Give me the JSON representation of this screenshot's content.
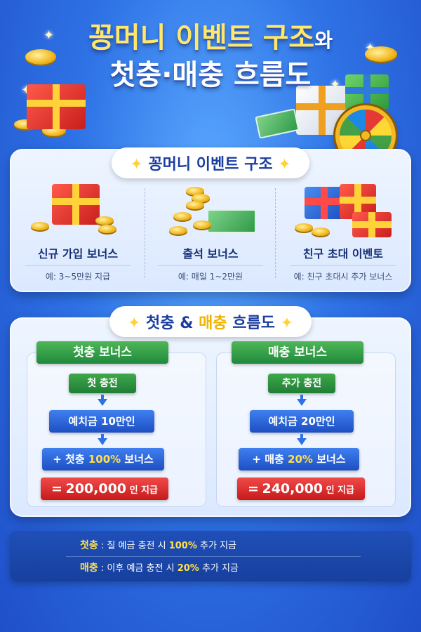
{
  "title": {
    "line1_main": "꽁머니 이벤트 구조",
    "line1_suffix": "와",
    "line2": "첫충·매충 흐름도"
  },
  "events_section": {
    "heading": "꽁머니 이벤트 구조",
    "items": [
      {
        "name": "신규 가입 보너스",
        "desc": "예: 3~5만원 지급"
      },
      {
        "name": "출석 보너스",
        "desc": "예: 매일 1~2만원"
      },
      {
        "name": "친구 초대 이벤토",
        "desc": "예: 친구 초대시 추가 보너스"
      }
    ]
  },
  "flow_section": {
    "heading_a": "첫충",
    "heading_amp": "&",
    "heading_b": "매충",
    "heading_c": "흐름도",
    "first": {
      "header": "첫충 보너스",
      "step1": "첫 충전",
      "step2": "예치금 10만인",
      "step3_prefix": "+ 첫충",
      "step3_pct": "100%",
      "step3_suffix": "보너스",
      "result_prefix": "=",
      "result_amount": "200,000",
      "result_suffix": "인 지급"
    },
    "reload": {
      "header": "매충 보너스",
      "step1": "추가 충전",
      "step2": "예치금 20만인",
      "step3_prefix": "+ 매충",
      "step3_pct": "20%",
      "step3_suffix": "보너스",
      "result_prefix": "=",
      "result_amount": "240,000",
      "result_suffix": "인 지급"
    }
  },
  "notes": [
    {
      "key": "첫충",
      "text_before": ": 칠 예금 충전 시",
      "pct": "100%",
      "text_after": "추가 지금"
    },
    {
      "key": "매충",
      "text_before": ": 이후 예금 충전 시",
      "pct": "20%",
      "text_after": "추가 지금"
    }
  ]
}
